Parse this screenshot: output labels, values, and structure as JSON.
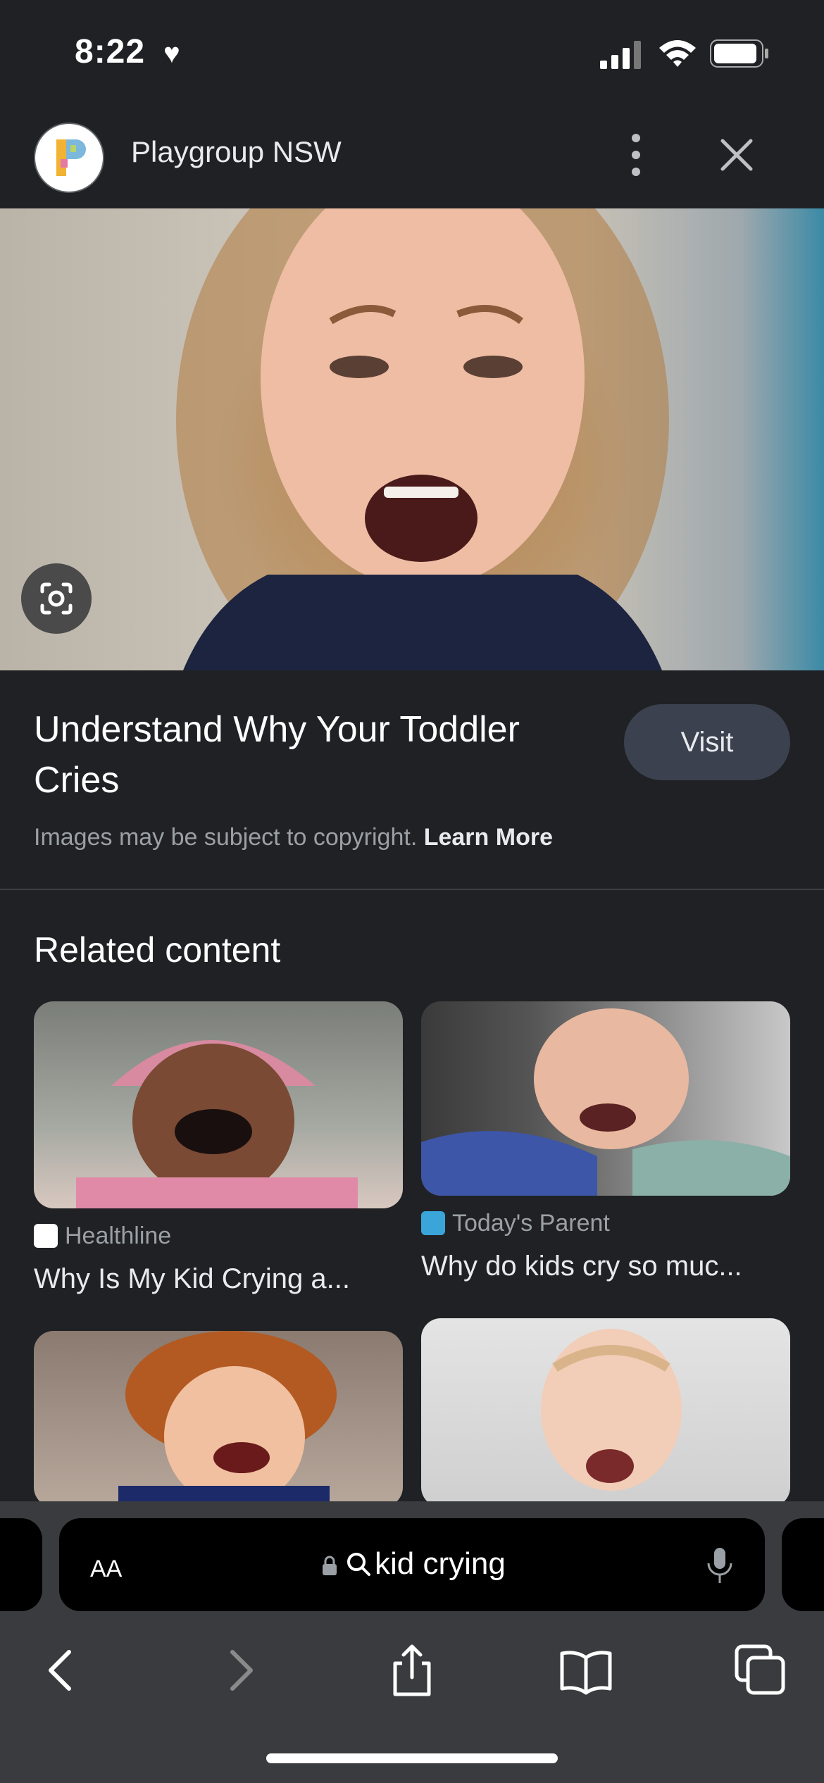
{
  "status_bar": {
    "time": "8:22"
  },
  "header": {
    "site_name": "Playgroup NSW"
  },
  "result": {
    "title": "Understand Why Your Toddler Cries",
    "visit_label": "Visit",
    "copyright_text": "Images may be subject to copyright.",
    "learn_more": "Learn More"
  },
  "related": {
    "heading": "Related content",
    "items": [
      {
        "source": "Healthline",
        "caption": "Why Is My Kid Crying a..."
      },
      {
        "source": "Today's Parent",
        "caption": "Why do kids cry so muc..."
      }
    ]
  },
  "browser": {
    "aa_label": "AA",
    "url_text": "kid crying"
  }
}
